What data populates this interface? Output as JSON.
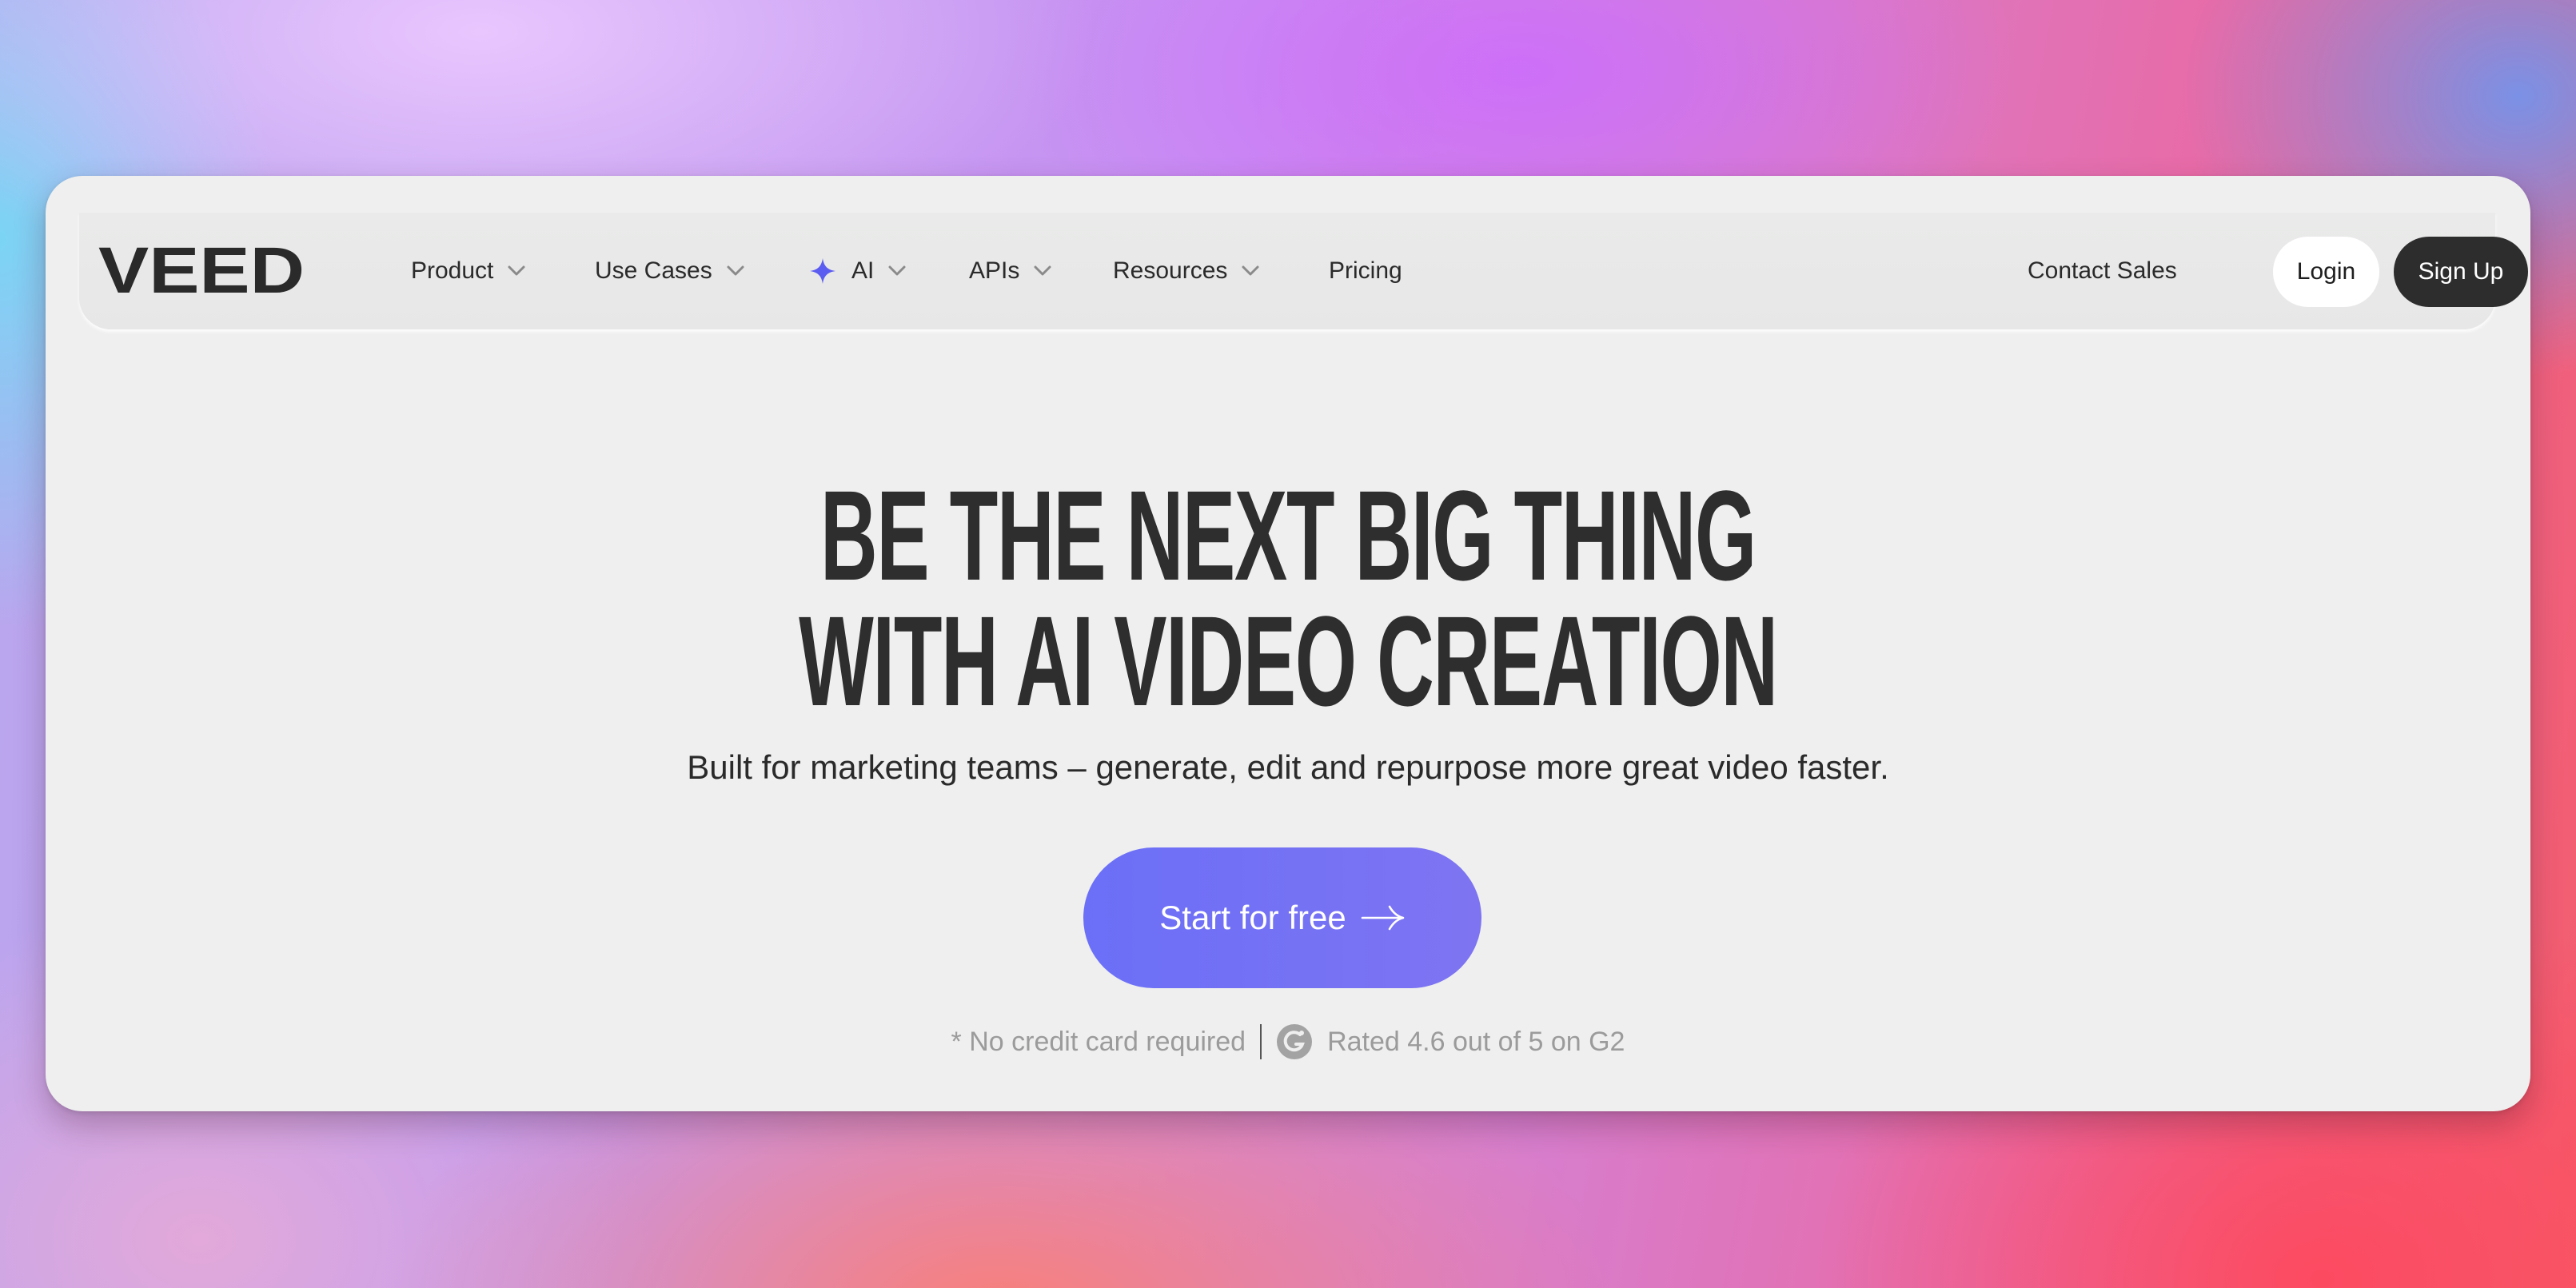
{
  "brand": {
    "logo_text": "VEED"
  },
  "nav": {
    "items": [
      {
        "label": "Product",
        "has_dropdown": true
      },
      {
        "label": "Use Cases",
        "has_dropdown": true
      },
      {
        "label": "AI",
        "has_dropdown": true,
        "icon": "sparkle-icon"
      },
      {
        "label": "APIs",
        "has_dropdown": true
      },
      {
        "label": "Resources",
        "has_dropdown": true
      },
      {
        "label": "Pricing",
        "has_dropdown": false
      }
    ],
    "contact_label": "Contact Sales",
    "login_label": "Login",
    "signup_label": "Sign Up"
  },
  "hero": {
    "headline_line1": "BE THE NEXT BIG THING",
    "headline_line2": "WITH AI VIDEO CREATION",
    "subtitle": "Built for marketing teams – generate, edit and repurpose more great video faster.",
    "cta_label": "Start for free",
    "note_left": "* No credit card required",
    "note_right": "Rated 4.6 out of 5 on G2",
    "rating": 4.6,
    "rating_max": 5
  },
  "colors": {
    "card_bg": "#eeefee",
    "text_dark": "#2e2e2e",
    "cta_start": "#6b6ff7",
    "cta_end": "#7e74f2",
    "sparkle_accent": "#5b5cf0",
    "muted": "#9b9b9b"
  }
}
